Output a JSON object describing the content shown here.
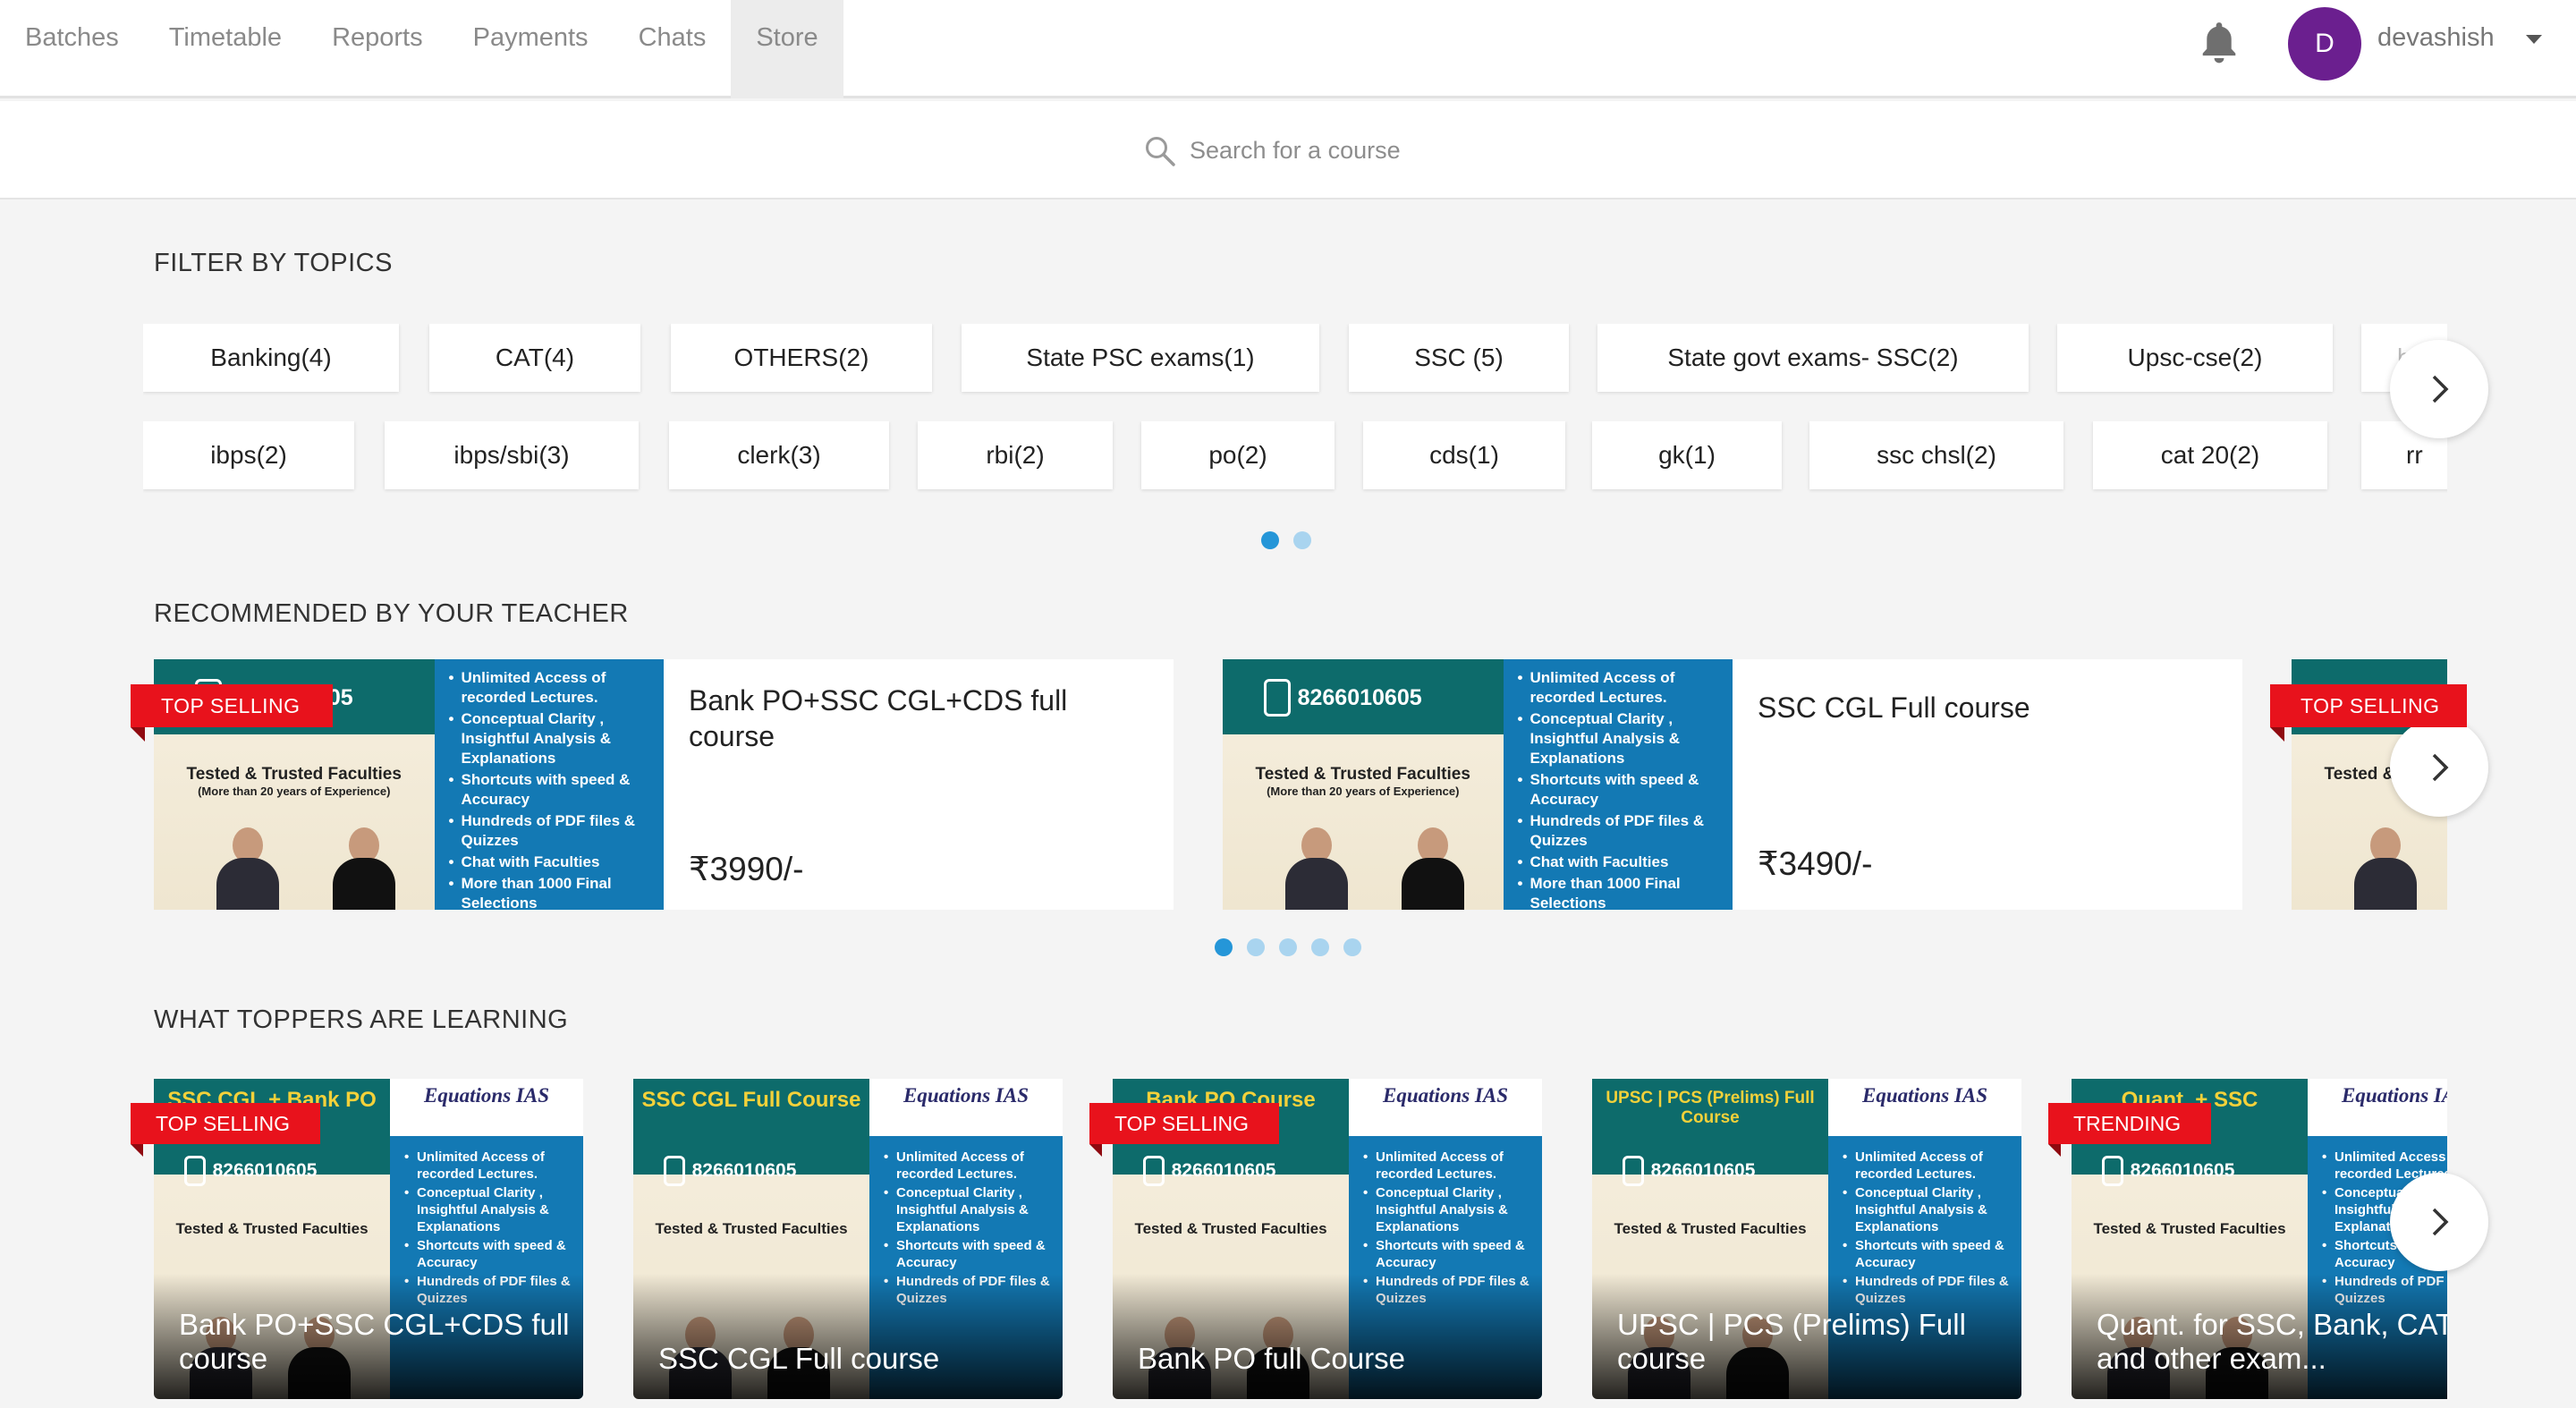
{
  "nav": {
    "tabs": [
      "Batches",
      "Timetable",
      "Reports",
      "Payments",
      "Chats",
      "Store"
    ],
    "active_tab": "Store",
    "user": {
      "initial": "D",
      "name": "devashish"
    }
  },
  "search": {
    "placeholder": "Search for a course"
  },
  "filter": {
    "title": "FILTER BY TOPICS",
    "row1": [
      "Banking(4)",
      "CAT(4)",
      "OTHERS(2)",
      "State PSC exams(1)",
      "SSC (5)",
      "State govt exams- SSC(2)",
      "Upsc-cse(2)",
      "ba"
    ],
    "row2": [
      "ibps(2)",
      "ibps/sbi(3)",
      "clerk(3)",
      "rbi(2)",
      "po(2)",
      "cds(1)",
      "gk(1)",
      "ssc chsl(2)",
      "cat 20(2)",
      "rr"
    ]
  },
  "recommended": {
    "title": "RECOMMENDED BY YOUR TEACHER",
    "cards": [
      {
        "title": "Bank PO+SSC CGL+CDS full course",
        "price": "₹3990/-",
        "badge": "TOP SELLING"
      },
      {
        "title": "SSC CGL Full course",
        "price": "₹3490/-",
        "badge": ""
      },
      {
        "title": "",
        "price": "",
        "badge": "TOP SELLING"
      }
    ]
  },
  "toppers": {
    "title": "WHAT TOPPERS ARE LEARNING",
    "cards": [
      {
        "title": "Bank PO+SSC CGL+CDS full course",
        "badge": "TOP SELLING",
        "art_title": "SSC CGL + Bank PO Course"
      },
      {
        "title": "SSC CGL Full course",
        "badge": "",
        "art_title": "SSC CGL Full Course"
      },
      {
        "title": "Bank PO full Course",
        "badge": "TOP SELLING",
        "art_title": "Bank PO Course"
      },
      {
        "title": "UPSC | PCS (Prelims) Full course",
        "badge": "",
        "art_title": "UPSC | PCS (Prelims) Full Course"
      },
      {
        "title": "Quant. for SSC, Bank, CAT and other exam...",
        "badge": "TRENDING",
        "art_title": "Quant. + SSC"
      }
    ]
  },
  "thumb": {
    "phone": "8266010605",
    "brand": "Equations IAS",
    "tested": "Tested & Trusted Faculties",
    "experience": "(More than 20 years of Experience)",
    "features": [
      "Unlimited Access of recorded Lectures.",
      "Conceptual Clarity , Insightful Analysis & Explanations",
      "Shortcuts with speed & Accuracy",
      "Hundreds of PDF files & Quizzes",
      "Chat with Faculties",
      "More than 1000 Final Selections"
    ]
  },
  "colors": {
    "accent": "#2596d8",
    "ribbon": "#e8121c",
    "avatar": "#6b1f8f",
    "thumb_teal": "#0d6b6b",
    "thumb_blue": "#1379b4"
  },
  "icons": {
    "bell": "bell-icon",
    "search": "search-icon",
    "caret": "chevron-down-icon",
    "arrow": "chevron-right-icon"
  }
}
